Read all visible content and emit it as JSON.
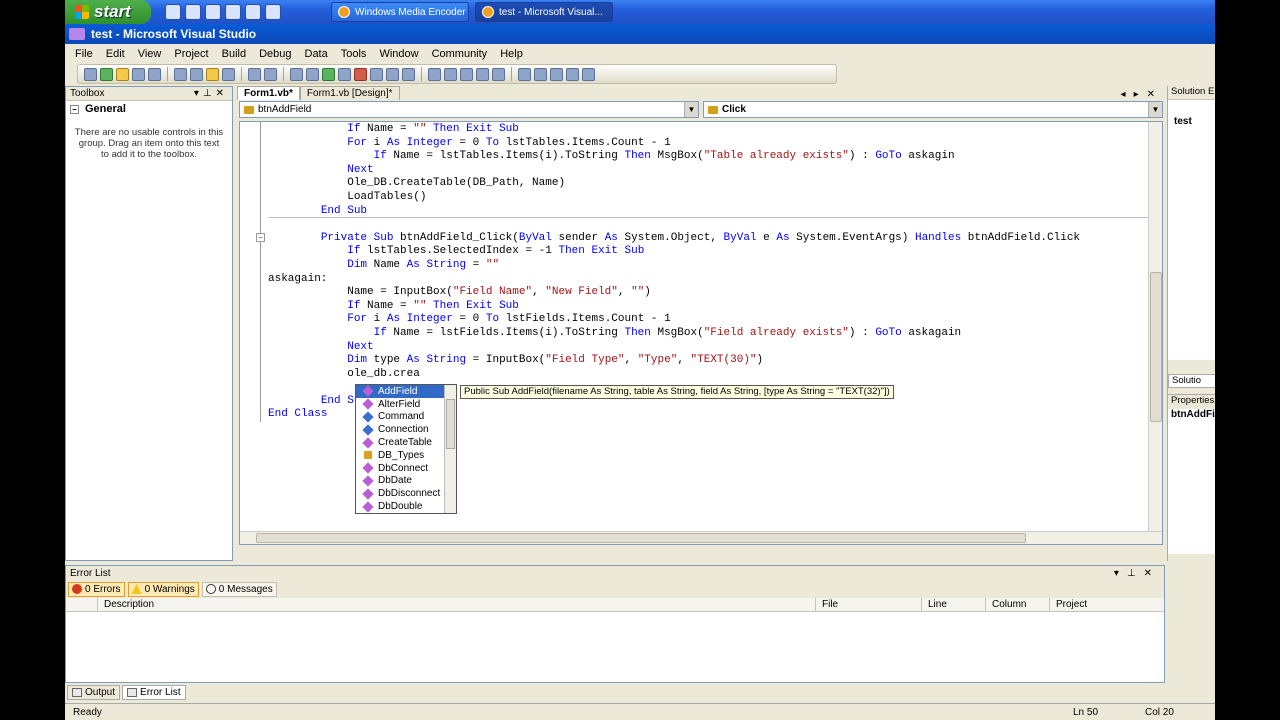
{
  "taskbar": {
    "start": "start",
    "tasks": [
      "Windows Media Encoder",
      "test - Microsoft Visual..."
    ]
  },
  "window": {
    "title": "test - Microsoft Visual Studio"
  },
  "menu": [
    "File",
    "Edit",
    "View",
    "Project",
    "Build",
    "Debug",
    "Data",
    "Tools",
    "Window",
    "Community",
    "Help"
  ],
  "toolbox": {
    "title": "Toolbox",
    "group": "General",
    "message": "There are no usable controls in this group. Drag an item onto this text to add it to the toolbox."
  },
  "tabs": {
    "code": "Form1.vb*",
    "design": "Form1.vb [Design]*"
  },
  "nav": {
    "object": "btnAddField",
    "member": "Click"
  },
  "code_lines": [
    "            If Name = \"\" Then Exit Sub",
    "            For i As Integer = 0 To lstTables.Items.Count - 1",
    "                If Name = lstTables.Items(i).ToString Then MsgBox(\"Table already exists\") : GoTo askagin",
    "            Next",
    "            Ole_DB.CreateTable(DB_Path, Name)",
    "            LoadTables()",
    "        End Sub",
    "",
    "        Private Sub btnAddField_Click(ByVal sender As System.Object, ByVal e As System.EventArgs) Handles btnAddField.Click",
    "            If lstTables.SelectedIndex = -1 Then Exit Sub",
    "            Dim Name As String = \"\"",
    "askagain:",
    "            Name = InputBox(\"Field Name\", \"New Field\", \"\")",
    "            If Name = \"\" Then Exit Sub",
    "            For i As Integer = 0 To lstFields.Items.Count - 1",
    "                If Name = lstFields.Items(i).ToString Then MsgBox(\"Field already exists\") : GoTo askagain",
    "            Next",
    "            Dim type As String = InputBox(\"Field Type\", \"Type\", \"TEXT(30)\")",
    "            ole_db.crea",
    "",
    "        End Sub",
    "End Class"
  ],
  "completion": {
    "items": [
      "AddField",
      "AlterField",
      "Command",
      "Connection",
      "CreateTable",
      "DB_Types",
      "DbConnect",
      "DbDate",
      "DbDisconnect",
      "DbDouble"
    ],
    "tooltip": "Public Sub AddField(filename As String, table As String, field As String, [type As String = \"TEXT(32)\"])"
  },
  "solution_explorer": {
    "title": "Solution E",
    "root": "test"
  },
  "properties": {
    "tab": "Solutio",
    "title": "Properties",
    "object": "btnAddFi"
  },
  "errorlist": {
    "title": "Error List",
    "errors": "0 Errors",
    "warnings": "0 Warnings",
    "messages": "0 Messages",
    "columns": [
      "Description",
      "File",
      "Line",
      "Column",
      "Project"
    ]
  },
  "bottom_tabs": [
    "Output",
    "Error List"
  ],
  "status": {
    "text": "Ready",
    "ln": "Ln 50",
    "col": "Col 20"
  }
}
